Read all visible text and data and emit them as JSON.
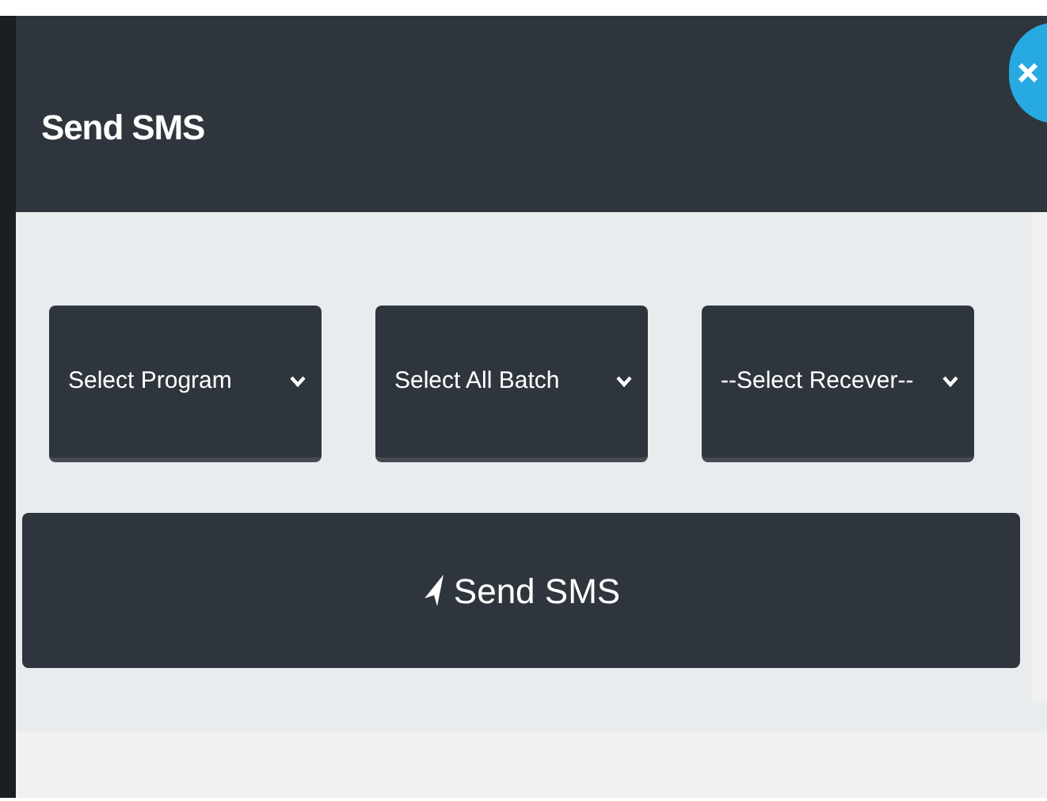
{
  "dialog": {
    "title": "Send SMS"
  },
  "selects": [
    {
      "placeholder": "Select Program"
    },
    {
      "placeholder": "Select All Batch"
    },
    {
      "placeholder": "--Select Recever--"
    }
  ],
  "send_button": {
    "label": "Send SMS"
  }
}
